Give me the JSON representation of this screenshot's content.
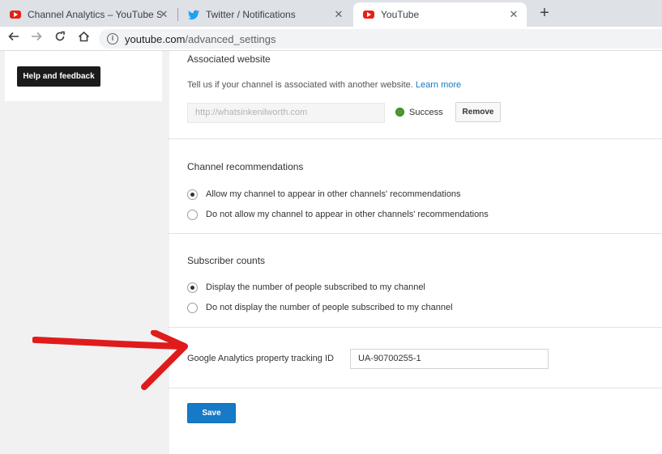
{
  "browser": {
    "tabs": [
      {
        "title": "Channel Analytics – YouTube Stu",
        "icon": "youtube-icon",
        "active": false
      },
      {
        "title": "Twitter / Notifications",
        "icon": "twitter-icon",
        "active": false
      },
      {
        "title": "YouTube",
        "icon": "youtube-icon",
        "active": true
      }
    ],
    "tab_close": "✕",
    "new_tab": "+",
    "url_host": "youtube.com",
    "url_path": "/advanced_settings"
  },
  "sidebar": {
    "help_button": "Help and feedback"
  },
  "associated_website": {
    "title": "Associated website",
    "description": "Tell us if your channel is associated with another website.",
    "learn_more": "Learn more",
    "url_value": "http://whatsinkenilworth.com",
    "status": "Success",
    "remove_button": "Remove"
  },
  "recommendations": {
    "title": "Channel recommendations",
    "options": [
      {
        "label": "Allow my channel to appear in other channels' recommendations",
        "checked": true
      },
      {
        "label": "Do not allow my channel to appear in other channels' recommendations",
        "checked": false
      }
    ]
  },
  "subscriber_counts": {
    "title": "Subscriber counts",
    "options": [
      {
        "label": "Display the number of people subscribed to my channel",
        "checked": true
      },
      {
        "label": "Do not display the number of people subscribed to my channel",
        "checked": false
      }
    ]
  },
  "analytics": {
    "label": "Google Analytics property tracking ID",
    "value": "UA-90700255-1"
  },
  "save_button": "Save",
  "colors": {
    "accent": "#167ac6",
    "annotation_arrow": "#e01b1b",
    "success": "#4a9b30"
  }
}
